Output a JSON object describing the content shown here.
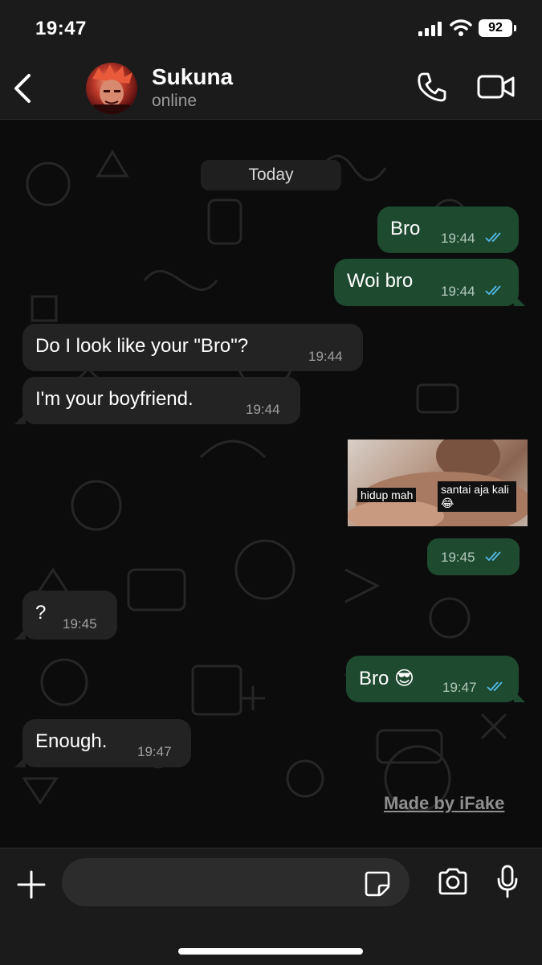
{
  "status_bar": {
    "time": "19:47",
    "battery": "92"
  },
  "header": {
    "contact_name": "Sukuna",
    "contact_status": "online"
  },
  "chat": {
    "date_label": "Today",
    "messages": [
      {
        "dir": "out",
        "text": "Bro",
        "time": "19:44"
      },
      {
        "dir": "out",
        "text": "Woi bro",
        "time": "19:44"
      },
      {
        "dir": "in",
        "text": "Do I look like your \"Bro\"?",
        "time": "19:44"
      },
      {
        "dir": "in",
        "text": "I'm your boyfriend.",
        "time": "19:44"
      },
      {
        "dir": "out",
        "sticker_caption_left": "hidup mah",
        "sticker_caption_right": "santai aja kali😂",
        "time": "19:45"
      },
      {
        "dir": "in",
        "text": "?",
        "time": "19:45"
      },
      {
        "dir": "out",
        "text": "Bro 😎",
        "time": "19:47"
      },
      {
        "dir": "in",
        "text": "Enough.",
        "time": "19:47"
      }
    ],
    "watermark": "Made by iFake"
  },
  "composer": {
    "placeholder": ""
  },
  "colors": {
    "outgoing_bubble": "#1e4a30",
    "incoming_bubble": "#232323",
    "read_ticks": "#53bdeb"
  }
}
